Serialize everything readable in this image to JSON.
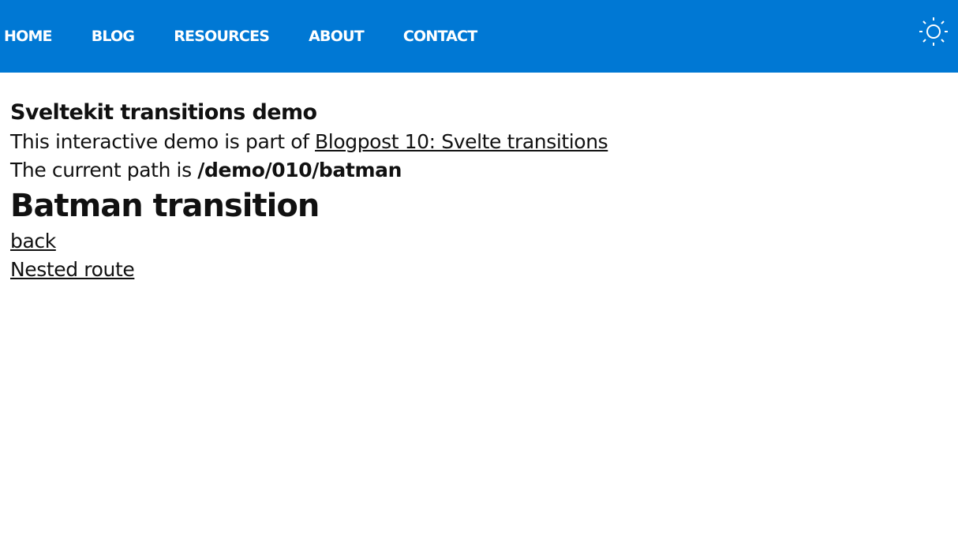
{
  "nav": {
    "items": [
      {
        "label": "HOME"
      },
      {
        "label": "BLOG"
      },
      {
        "label": "RESOURCES"
      },
      {
        "label": "ABOUT"
      },
      {
        "label": "CONTACT"
      }
    ],
    "theme_toggle_icon": "sun-icon",
    "background_color": "#0078d4"
  },
  "content": {
    "title": "Sveltekit transitions demo",
    "intro_text": "This interactive demo is part of ",
    "intro_link": "Blogpost 10: Svelte transitions",
    "path_prefix": "The current path is ",
    "path_value": "/demo/010/batman",
    "heading": "Batman transition",
    "back_link": "back",
    "nested_link": "Nested route"
  }
}
